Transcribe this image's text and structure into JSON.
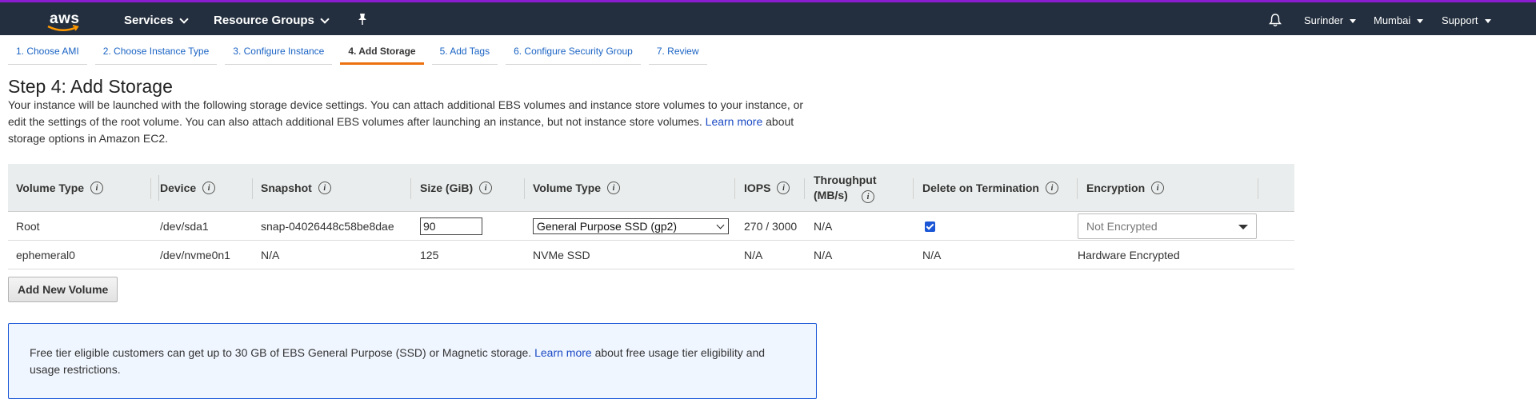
{
  "nav": {
    "logo": "aws",
    "services": "Services",
    "resource_groups": "Resource Groups",
    "user": "Surinder",
    "region": "Mumbai",
    "support": "Support"
  },
  "tabs": [
    {
      "label": "1. Choose AMI"
    },
    {
      "label": "2. Choose Instance Type"
    },
    {
      "label": "3. Configure Instance"
    },
    {
      "label": "4. Add Storage",
      "active": true
    },
    {
      "label": "5. Add Tags"
    },
    {
      "label": "6. Configure Security Group"
    },
    {
      "label": "7. Review"
    }
  ],
  "page": {
    "title": "Step 4: Add Storage",
    "desc_1": "Your instance will be launched with the following storage device settings. You can attach additional EBS volumes and instance store volumes to your instance, or edit the settings of the root volume. You can also attach additional EBS volumes after launching an instance, but not instance store volumes.",
    "desc_link": "Learn more",
    "desc_2": "about storage options in Amazon EC2."
  },
  "table": {
    "headers": {
      "volume_type": "Volume Type",
      "device": "Device",
      "snapshot": "Snapshot",
      "size": "Size (GiB)",
      "vol_type": "Volume Type",
      "iops": "IOPS",
      "throughput": "Throughput (MB/s)",
      "delete": "Delete on Termination",
      "encryption": "Encryption"
    },
    "rows": [
      {
        "volume_type": "Root",
        "device": "/dev/sda1",
        "snapshot": "snap-04026448c58be8dae",
        "size": "90",
        "vol_type": "General Purpose SSD (gp2)",
        "iops": "270 / 3000",
        "throughput": "N/A",
        "delete_checked": true,
        "encryption": "Not Encrypted"
      },
      {
        "volume_type": "ephemeral0",
        "device": "/dev/nvme0n1",
        "snapshot": "N/A",
        "size": "125",
        "vol_type": "NVMe SSD",
        "iops": "N/A",
        "throughput": "N/A",
        "delete": "N/A",
        "encryption": "Hardware Encrypted"
      }
    ]
  },
  "add_button": "Add New Volume",
  "info": {
    "text_1": "Free tier eligible customers can get up to 30 GB of EBS General Purpose (SSD) or Magnetic storage.",
    "link": "Learn more",
    "text_2": "about free usage tier eligibility and usage restrictions."
  },
  "colors": {
    "nav_bg": "#232f3e",
    "nav_accent": "#8a1ecf",
    "active_tab": "#ec7211",
    "link": "#1a49c4"
  },
  "icons": {
    "bell": "bell-icon",
    "pin": "pin-icon",
    "info": "info-icon"
  }
}
